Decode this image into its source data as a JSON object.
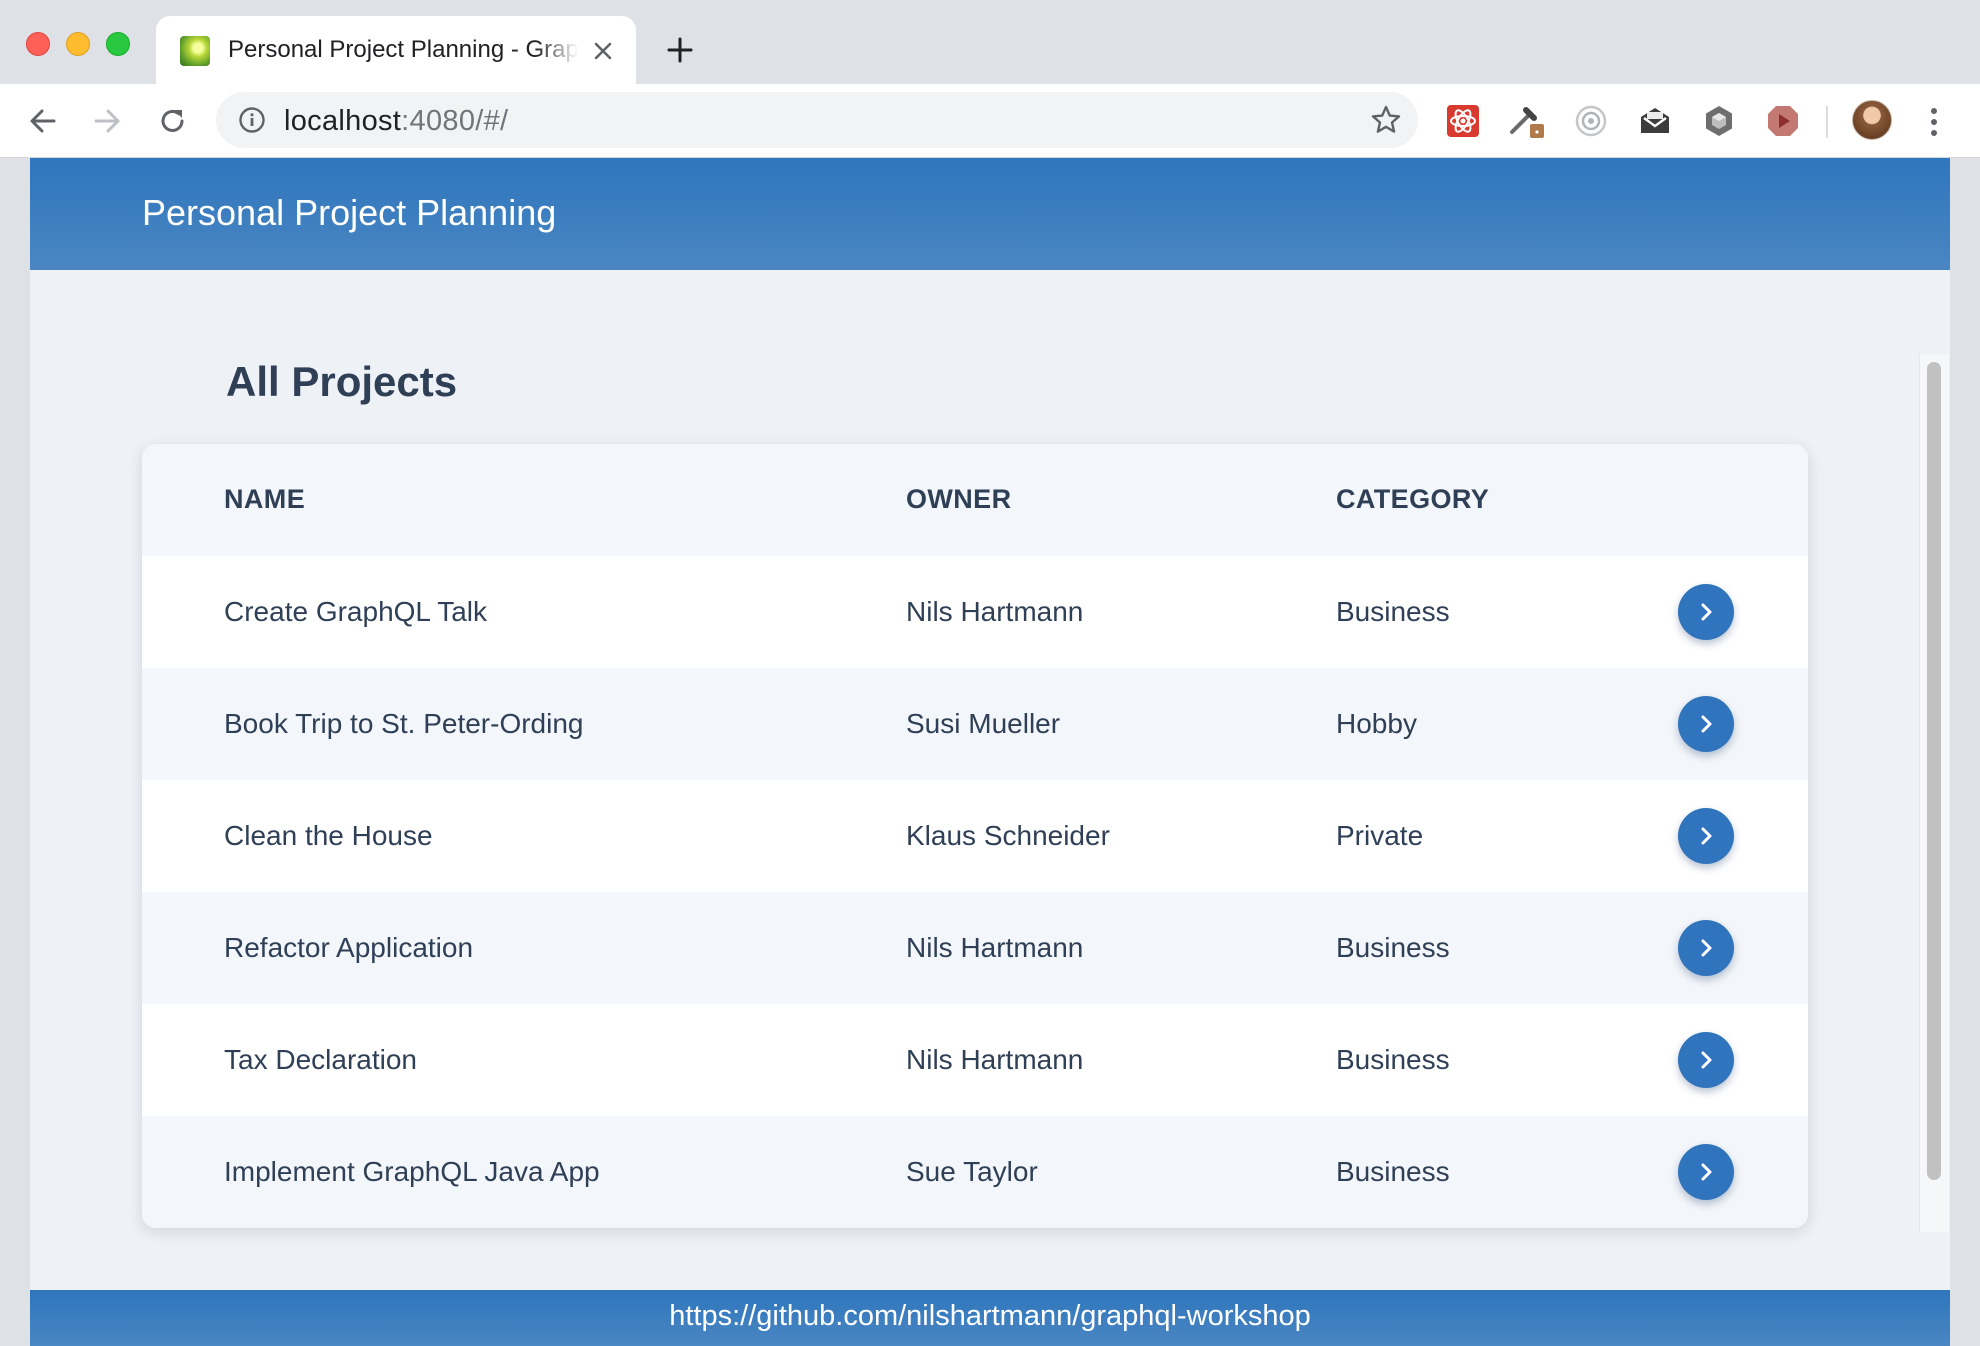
{
  "browser": {
    "tab_title": "Personal Project Planning - GraphQL Workshop",
    "url_host": "localhost",
    "url_rest": ":4080/#/"
  },
  "app": {
    "title": "Personal Project Planning",
    "heading": "All Projects",
    "footer_link": "https://github.com/nilshartmann/graphql-workshop"
  },
  "table": {
    "columns": [
      "NAME",
      "OWNER",
      "CATEGORY"
    ],
    "rows": [
      {
        "name": "Create GraphQL Talk",
        "owner": "Nils Hartmann",
        "category": "Business"
      },
      {
        "name": "Book Trip to St. Peter-Ording",
        "owner": "Susi Mueller",
        "category": "Hobby"
      },
      {
        "name": "Clean the House",
        "owner": "Klaus Schneider",
        "category": "Private"
      },
      {
        "name": "Refactor Application",
        "owner": "Nils Hartmann",
        "category": "Business"
      },
      {
        "name": "Tax Declaration",
        "owner": "Nils Hartmann",
        "category": "Business"
      },
      {
        "name": "Implement GraphQL Java App",
        "owner": "Sue Taylor",
        "category": "Business"
      }
    ]
  },
  "colors": {
    "accent": "#2f74bc",
    "header_bg": "#2e76bd",
    "page_bg": "#eef1f5",
    "text": "#2f3f56"
  },
  "icons": {
    "extensions": [
      "react-devtools-icon",
      "eyedropper-icon",
      "target-icon",
      "mail-icon",
      "cube-icon",
      "play-icon"
    ],
    "row_action": "chevron-right-icon"
  }
}
